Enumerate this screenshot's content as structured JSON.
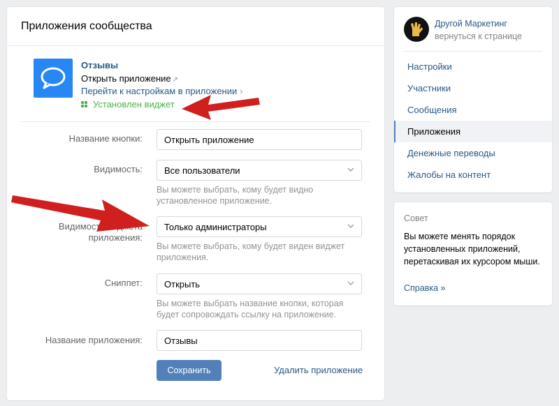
{
  "header": {
    "title": "Приложения сообщества"
  },
  "app": {
    "name": "Отзывы",
    "open_label": "Открыть приложение",
    "settings_label": "Перейти к настройкам в приложении",
    "widget_status": "Установлен виджет",
    "icon": "message-bubble-icon"
  },
  "form": {
    "button_name": {
      "label": "Название кнопки:",
      "value": "Открыть приложение"
    },
    "visibility": {
      "label": "Видимость:",
      "value": "Все пользователи",
      "hint": "Вы можете выбрать, кому будет видно установленное приложение."
    },
    "widget_visibility": {
      "label": "Видимость виджета приложения:",
      "value": "Только администраторы",
      "hint": "Вы можете выбрать, кому будет виден виджет приложения."
    },
    "snippet": {
      "label": "Сниппет:",
      "value": "Открыть",
      "hint": "Вы можете выбрать название кнопки, которая будет сопровождать ссылку на приложение."
    },
    "app_name": {
      "label": "Название приложения:",
      "value": "Отзывы"
    },
    "save_label": "Сохранить",
    "delete_label": "Удалить приложение"
  },
  "sidebar": {
    "group_name": "Другой Маркетинг",
    "back_label": "вернуться к странице",
    "items": [
      {
        "label": "Настройки"
      },
      {
        "label": "Участники"
      },
      {
        "label": "Сообщения"
      },
      {
        "label": "Приложения"
      },
      {
        "label": "Денежные переводы"
      },
      {
        "label": "Жалобы на контент"
      }
    ],
    "active_index": 3
  },
  "tip": {
    "title": "Совет",
    "text": "Вы можете менять порядок установленных приложений, перетаскивая их курсором мыши.",
    "link": "Справка »"
  },
  "colors": {
    "accent": "#2a5885",
    "button": "#5181b8",
    "success": "#4bb34b",
    "arrow": "#d01f1f"
  }
}
